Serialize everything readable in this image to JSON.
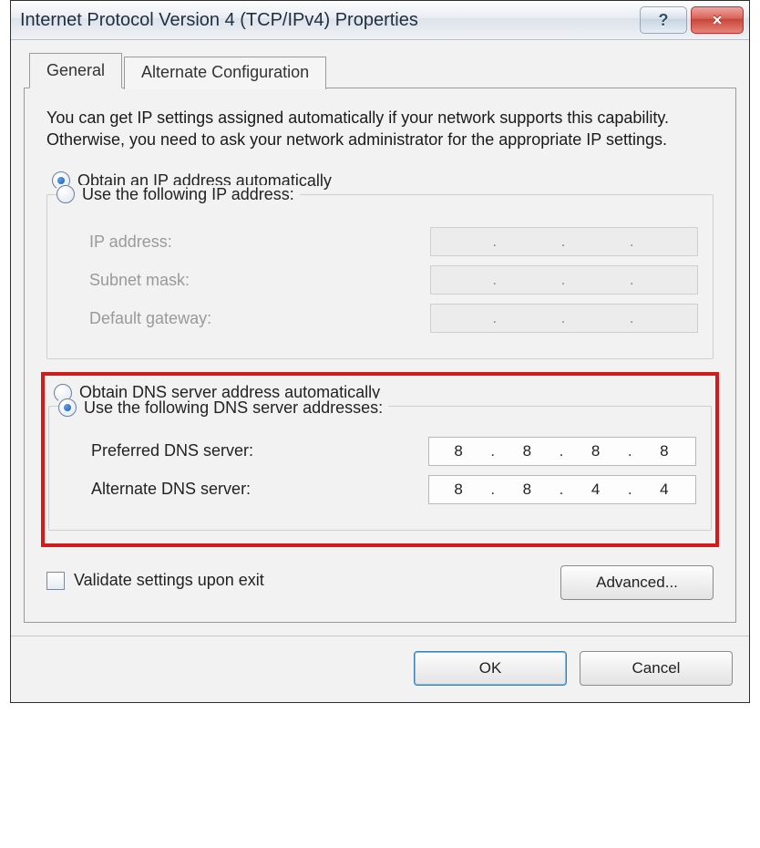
{
  "window": {
    "title": "Internet Protocol Version 4 (TCP/IPv4) Properties",
    "help_glyph": "?",
    "close_glyph": "×"
  },
  "tabs": {
    "general": "General",
    "alternate": "Alternate Configuration"
  },
  "description": "You can get IP settings assigned automatically if your network supports this capability. Otherwise, you need to ask your network administrator for the appropriate IP settings.",
  "ip_section": {
    "auto_label": "Obtain an IP address automatically",
    "manual_label": "Use the following IP address:",
    "selected": "auto",
    "fields": {
      "ip_label": "IP address:",
      "subnet_label": "Subnet mask:",
      "gateway_label": "Default gateway:",
      "ip_value": [
        "",
        "",
        "",
        ""
      ],
      "subnet_value": [
        "",
        "",
        "",
        ""
      ],
      "gateway_value": [
        "",
        "",
        "",
        ""
      ]
    }
  },
  "dns_section": {
    "auto_label": "Obtain DNS server address automatically",
    "manual_label": "Use the following DNS server addresses:",
    "selected": "manual",
    "fields": {
      "preferred_label": "Preferred DNS server:",
      "alternate_label": "Alternate DNS server:",
      "preferred_value": [
        "8",
        "8",
        "8",
        "8"
      ],
      "alternate_value": [
        "8",
        "8",
        "4",
        "4"
      ]
    }
  },
  "validate_label": "Validate settings upon exit",
  "validate_checked": false,
  "advanced_label": "Advanced...",
  "buttons": {
    "ok": "OK",
    "cancel": "Cancel"
  },
  "highlight_color": "#d11c1c"
}
